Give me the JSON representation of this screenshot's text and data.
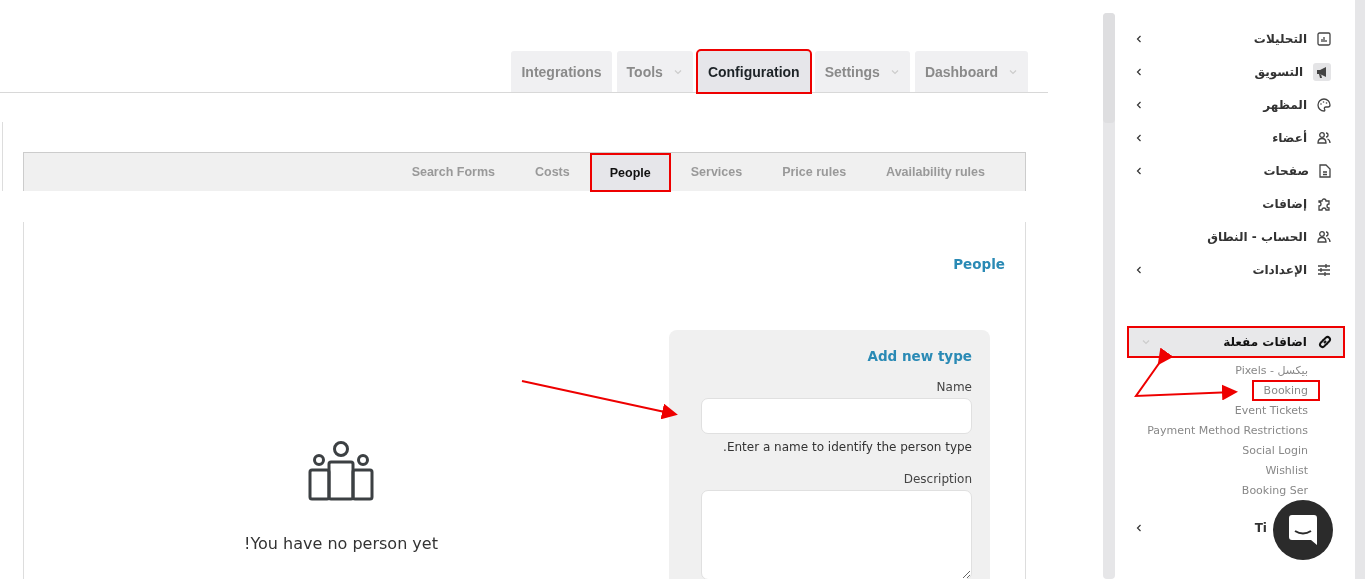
{
  "top_tabs": [
    {
      "label": "Dashboard",
      "dropdown": true,
      "selected": false,
      "highlighted": false
    },
    {
      "label": "Settings",
      "dropdown": true,
      "selected": false,
      "highlighted": false
    },
    {
      "label": "Configuration",
      "dropdown": false,
      "selected": true,
      "highlighted": true
    },
    {
      "label": "Tools",
      "dropdown": true,
      "selected": false,
      "highlighted": false
    },
    {
      "label": "Integrations",
      "dropdown": false,
      "selected": false,
      "highlighted": false
    }
  ],
  "sub_tabs": [
    {
      "label": "Availability rules",
      "selected": false,
      "highlighted": false
    },
    {
      "label": "Price rules",
      "selected": false,
      "highlighted": false
    },
    {
      "label": "Services",
      "selected": false,
      "highlighted": false
    },
    {
      "label": "People",
      "selected": true,
      "highlighted": true
    },
    {
      "label": "Costs",
      "selected": false,
      "highlighted": false
    },
    {
      "label": "Search Forms",
      "selected": false,
      "highlighted": false
    }
  ],
  "section_title": "People",
  "empty_state": {
    "message": "!You have no person yet"
  },
  "form": {
    "title": "Add new type",
    "fields": [
      {
        "kind": "input",
        "label": "Name",
        "help": ".Enter a name to identify the person type"
      },
      {
        "kind": "textarea",
        "label": "Description"
      }
    ]
  },
  "sidebar": {
    "items": [
      {
        "label": "التحليلات",
        "has_children": true
      },
      {
        "label": "التسويق",
        "has_children": true
      },
      {
        "label": "المظهر",
        "has_children": true
      },
      {
        "label": "أعضاء",
        "has_children": true
      },
      {
        "label": "صفحات",
        "has_children": true
      },
      {
        "label": "إضافات",
        "has_children": false
      },
      {
        "label": "الحساب - النطاق",
        "has_children": false
      },
      {
        "label": "الإعدادات",
        "has_children": true
      }
    ],
    "active_group": {
      "label": "اضافات مفعلة",
      "expanded": true,
      "highlighted": true,
      "children": [
        {
          "label": "بيكسل - Pixels",
          "highlighted": false
        },
        {
          "label": "Booking",
          "highlighted": true
        },
        {
          "label": "Event Tickets",
          "highlighted": false
        },
        {
          "label": "Payment Method Restrictions",
          "highlighted": false
        },
        {
          "label": "Social Login",
          "highlighted": false
        },
        {
          "label": "Wishlist",
          "highlighted": false
        },
        {
          "label": "Booking Ser",
          "highlighted": false
        }
      ]
    },
    "next_item": {
      "label": "Ti",
      "has_children": true
    }
  }
}
